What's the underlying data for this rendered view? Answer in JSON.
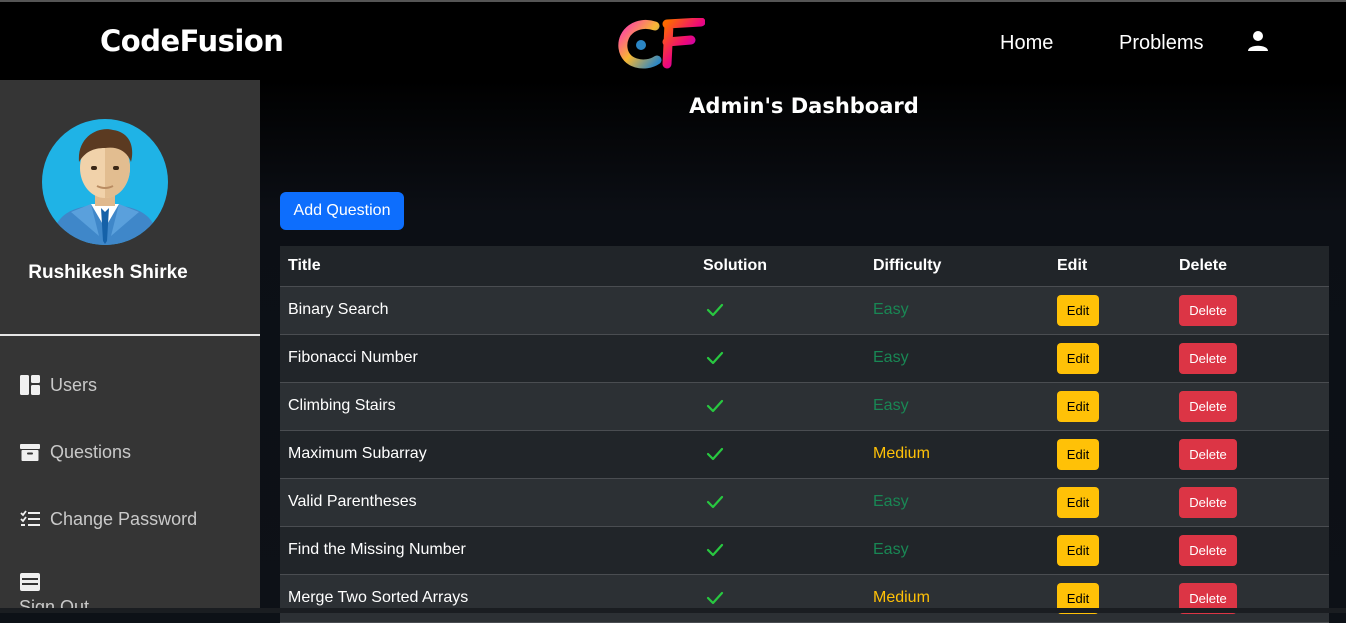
{
  "header": {
    "brand": "CodeFusion",
    "logo_text": "CF",
    "nav": {
      "home": "Home",
      "problems": "Problems"
    },
    "user_icon": "user-icon"
  },
  "sidebar": {
    "profile_name": "Rushikesh Shirke",
    "items": [
      {
        "label": "Users",
        "icon": "dashboard-icon"
      },
      {
        "label": "Questions",
        "icon": "archive-icon"
      },
      {
        "label": "Change Password",
        "icon": "list-check-icon"
      },
      {
        "label": "Sign Out",
        "icon": "card-icon"
      }
    ]
  },
  "main": {
    "title": "Admin's Dashboard",
    "add_button": "Add Question",
    "table": {
      "headers": {
        "title": "Title",
        "solution": "Solution",
        "difficulty": "Difficulty",
        "edit": "Edit",
        "delete": "Delete"
      },
      "edit_label": "Edit",
      "delete_label": "Delete",
      "rows": [
        {
          "title": "Binary Search",
          "difficulty": "Easy"
        },
        {
          "title": "Fibonacci Number",
          "difficulty": "Easy"
        },
        {
          "title": "Climbing Stairs",
          "difficulty": "Easy"
        },
        {
          "title": "Maximum Subarray",
          "difficulty": "Medium"
        },
        {
          "title": "Valid Parentheses",
          "difficulty": "Easy"
        },
        {
          "title": "Find the Missing Number",
          "difficulty": "Easy"
        },
        {
          "title": "Merge Two Sorted Arrays",
          "difficulty": "Medium"
        }
      ]
    }
  },
  "colors": {
    "easy": "#198754",
    "medium": "#ffc107",
    "edit": "#ffc107",
    "delete": "#dc3545",
    "primary": "#0d6efd"
  }
}
